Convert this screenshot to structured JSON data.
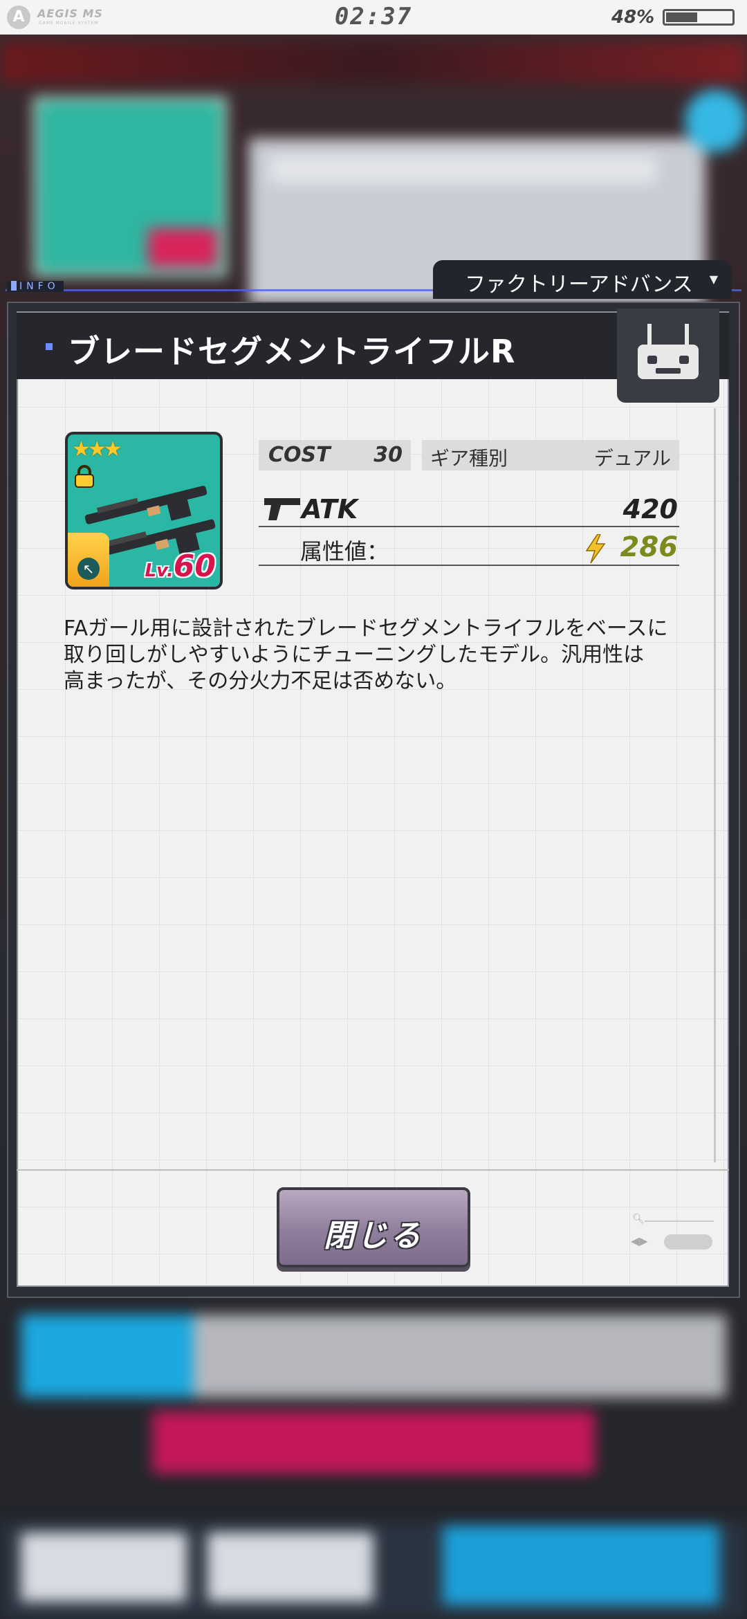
{
  "status_bar": {
    "app_logo": "A",
    "app_name": "AEGIS MS",
    "app_subtitle": "GAME MOBILE SYSTEM",
    "time": "02:37",
    "battery_percent": "48%",
    "battery_level": 0.48
  },
  "info_label": "INFO",
  "dropdown": {
    "label": "ファクトリーアドバンス"
  },
  "dialog": {
    "title": "ブレードセグメントライフルR",
    "item": {
      "stars": "★★★",
      "level_prefix": "Lv.",
      "level": "60"
    },
    "stats": {
      "cost_label": "COST",
      "cost_value": "30",
      "gear_label": "ギア種別",
      "gear_value": "デュアル",
      "atk_label": "ATK",
      "atk_value": "420",
      "attribute_label": "属性値：",
      "attribute_value": "286"
    },
    "description": "FAガール用に設計されたブレードセグメントライフルをベースに\n取り回しがしやすいようにチューニングしたモデル。汎用性は\n高まったが、その分火力不足は否めない。",
    "close_button": "閉じる"
  },
  "colors": {
    "title_bar": "#25272d",
    "level_text": "#d8144d",
    "attribute_value": "#7c8a1c",
    "card_bg": "#2ab8a4",
    "close_button": "#8f7f9c"
  }
}
